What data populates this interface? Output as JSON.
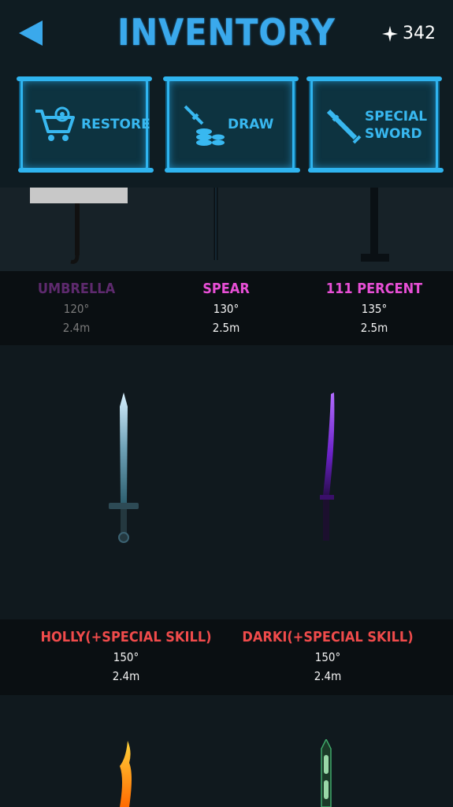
{
  "header": {
    "title": "INVENTORY",
    "currency_value": "342"
  },
  "signs": [
    {
      "label": "RESTORE",
      "icon": "shopping-cart-icon"
    },
    {
      "label": "DRAW",
      "icon": "sword-coins-icon"
    },
    {
      "label_line1": "SPECIAL",
      "label_line2": "SWORD",
      "icon": "sword-icon"
    }
  ],
  "row1": [
    {
      "name": "UMBRELLA",
      "angle": "120°",
      "range": "2.4m",
      "color": "#5e2a6e",
      "locked": true
    },
    {
      "name": "SPEAR",
      "angle": "130°",
      "range": "2.5m",
      "color": "#e84fd6",
      "locked": false
    },
    {
      "name": "111 PERCENT",
      "angle": "135°",
      "range": "2.5m",
      "color": "#e84fd6",
      "locked": false
    }
  ],
  "row2": [
    {
      "name": "HOLLY(+SPECIAL SKILL)",
      "angle": "150°",
      "range": "2.4m",
      "color": "#f04b4b"
    },
    {
      "name": "DARKI(+SPECIAL SKILL)",
      "angle": "150°",
      "range": "2.4m",
      "color": "#f04b4b"
    }
  ],
  "colors": {
    "accent": "#3aa9ec",
    "background": "#0e1a20"
  }
}
